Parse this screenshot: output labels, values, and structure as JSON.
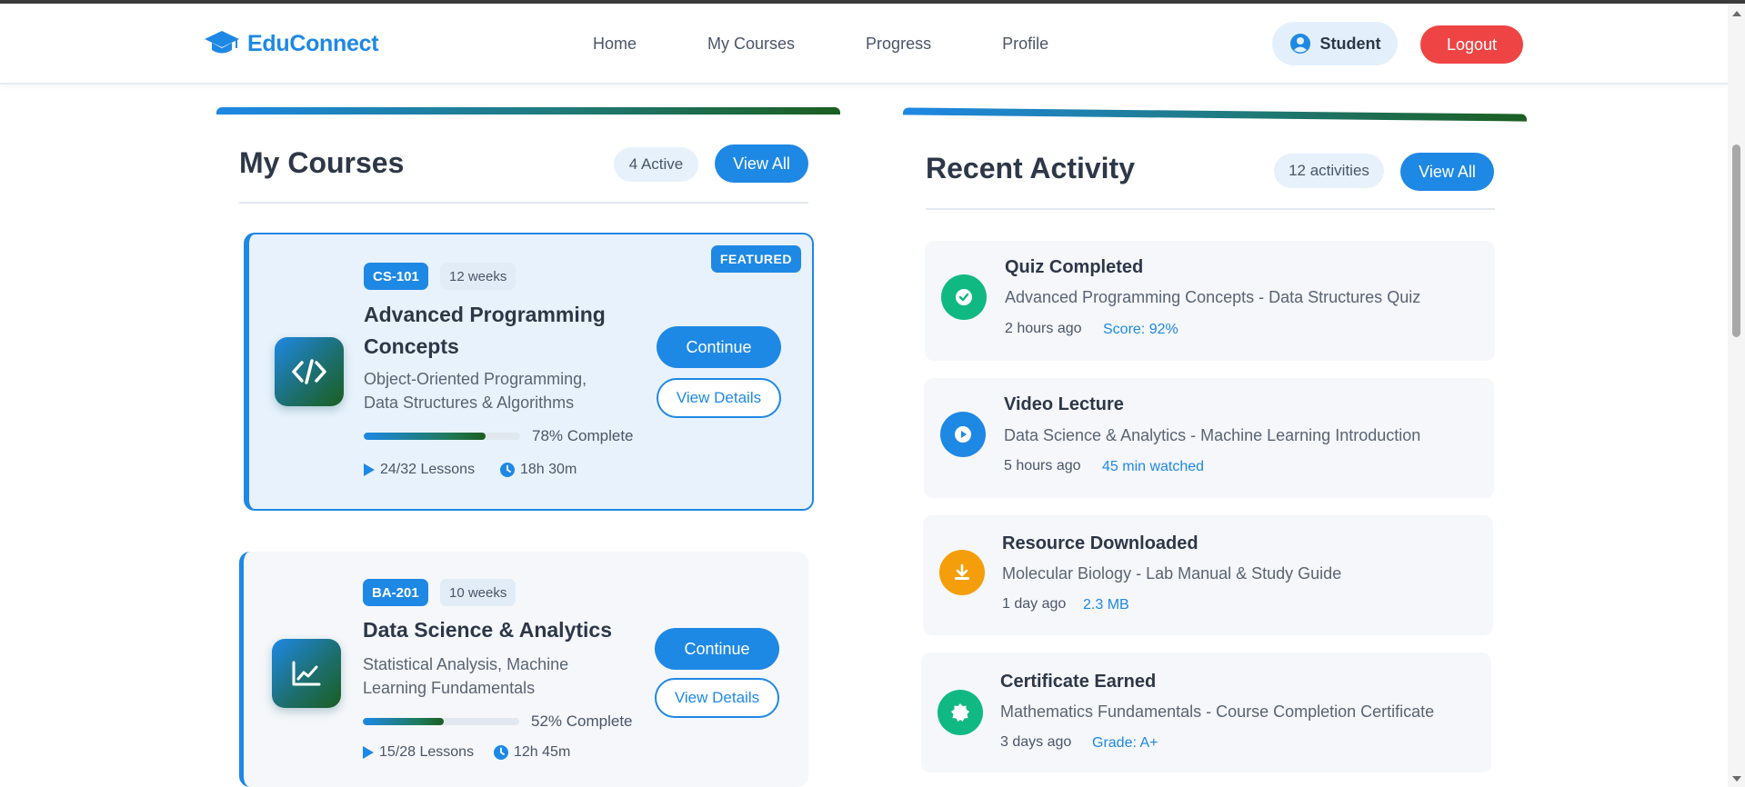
{
  "header": {
    "brand": "EduConnect",
    "nav": [
      "Home",
      "My Courses",
      "Progress",
      "Profile"
    ],
    "user_label": "Student",
    "logout_label": "Logout"
  },
  "courses_section": {
    "title": "My Courses",
    "badge": "4 Active",
    "view_all": "View All",
    "courses": [
      {
        "code": "CS-101",
        "weeks": "12 weeks",
        "featured_label": "FEATURED",
        "title_line1": "Advanced Programming",
        "title_line2": "Concepts",
        "desc_line1": "Object-Oriented Programming,",
        "desc_line2": "Data Structures & Algorithms",
        "progress": 78,
        "progress_label": "78% Complete",
        "lessons": "24/32 Lessons",
        "duration": "18h 30m",
        "icon": "code-icon",
        "continue_label": "Continue",
        "details_label": "View Details"
      },
      {
        "code": "BA-201",
        "weeks": "10 weeks",
        "title_line1": "Data Science & Analytics",
        "desc_line1": "Statistical Analysis, Machine",
        "desc_line2": "Learning Fundamentals",
        "progress": 52,
        "progress_label": "52% Complete",
        "lessons": "15/28 Lessons",
        "duration": "12h 45m",
        "icon": "chart-line-icon",
        "continue_label": "Continue",
        "details_label": "View Details"
      }
    ]
  },
  "activity_section": {
    "title": "Recent Activity",
    "badge": "12 activities",
    "view_all": "View All",
    "items": [
      {
        "title": "Quiz Completed",
        "desc": "Advanced Programming Concepts - Data Structures Quiz",
        "time": "2 hours ago",
        "extra": "Score: 92%",
        "icon": "check-circle-icon",
        "color": "#10b981"
      },
      {
        "title": "Video Lecture",
        "desc": "Data Science & Analytics - Machine Learning Introduction",
        "time": "5 hours ago",
        "extra": "45 min watched",
        "icon": "play-circle-icon",
        "color": "#1e88e5"
      },
      {
        "title": "Resource Downloaded",
        "desc": "Molecular Biology - Lab Manual & Study Guide",
        "time": "1 day ago",
        "extra": "2.3 MB",
        "icon": "download-icon",
        "color": "#f59e0b"
      },
      {
        "title": "Certificate Earned",
        "desc": "Mathematics Fundamentals - Course Completion Certificate",
        "time": "3 days ago",
        "extra": "Grade: A+",
        "icon": "certificate-icon",
        "color": "#10b981"
      }
    ]
  },
  "colors": {
    "primary": "#1e88e5",
    "danger": "#ef4444",
    "success": "#10b981",
    "warning": "#f59e0b",
    "gradient_end": "#1b5e20"
  }
}
